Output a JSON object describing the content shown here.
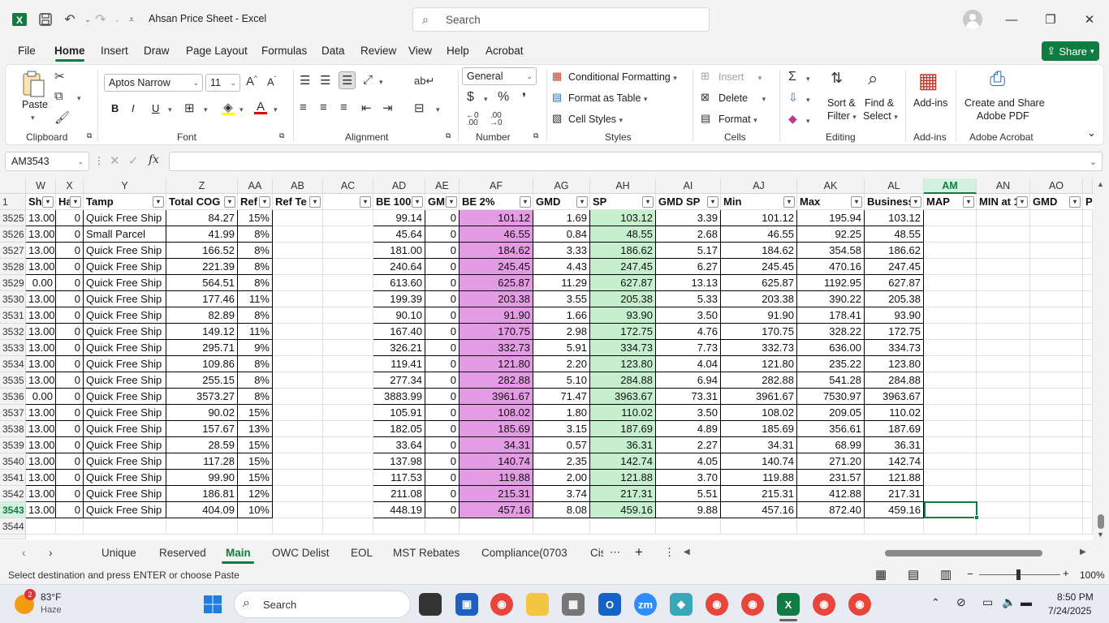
{
  "window": {
    "title": "Ahsan Price Sheet  -  Excel",
    "search_placeholder": "Search",
    "minimize": "—",
    "restore": "❐",
    "close": "✕"
  },
  "menu": {
    "items": [
      "File",
      "Home",
      "Insert",
      "Draw",
      "Page Layout",
      "Formulas",
      "Data",
      "Review",
      "View",
      "Help",
      "Acrobat"
    ],
    "share": "Share"
  },
  "ribbon": {
    "clipboard": {
      "paste": "Paste",
      "label": "Clipboard"
    },
    "font": {
      "name": "Aptos Narrow",
      "size": "11",
      "bold": "B",
      "italic": "I",
      "underline": "U",
      "label": "Font"
    },
    "alignment": {
      "label": "Alignment"
    },
    "number": {
      "format": "General",
      "label": "Number"
    },
    "styles": {
      "conditional": "Conditional Formatting",
      "format_table": "Format as Table",
      "cell_styles": "Cell Styles",
      "label": "Styles"
    },
    "cells": {
      "insert": "Insert",
      "delete": "Delete",
      "format": "Format",
      "label": "Cells"
    },
    "editing": {
      "sort1": "Sort &",
      "sort2": "Filter",
      "find1": "Find &",
      "find2": "Select",
      "label": "Editing"
    },
    "addins": {
      "btn": "Add-ins",
      "label": "Add-ins"
    },
    "acrobat": {
      "btn1": "Create and Share",
      "btn2": "Adobe PDF",
      "label": "Adobe Acrobat"
    }
  },
  "formula_bar": {
    "name_box": "AM3543",
    "fx": "fx",
    "value": ""
  },
  "grid": {
    "columns": [
      {
        "letter": "W",
        "header": "Sh"
      },
      {
        "letter": "X",
        "header": "Ha"
      },
      {
        "letter": "Y",
        "header": "Tamp"
      },
      {
        "letter": "Z",
        "header": "Total COG"
      },
      {
        "letter": "AA",
        "header": "Ref"
      },
      {
        "letter": "AB",
        "header": "Ref Te"
      },
      {
        "letter": "AC",
        "header": ""
      },
      {
        "letter": "AD",
        "header": "BE 100"
      },
      {
        "letter": "AE",
        "header": "GMI"
      },
      {
        "letter": "AF",
        "header": "BE 2%"
      },
      {
        "letter": "AG",
        "header": "GMD"
      },
      {
        "letter": "AH",
        "header": "SP"
      },
      {
        "letter": "AI",
        "header": "GMD SP"
      },
      {
        "letter": "AJ",
        "header": "Min"
      },
      {
        "letter": "AK",
        "header": "Max"
      },
      {
        "letter": "AL",
        "header": "Business"
      },
      {
        "letter": "AM",
        "header": "MAP"
      },
      {
        "letter": "AN",
        "header": "MIN at 1"
      },
      {
        "letter": "AO",
        "header": "GMD"
      },
      {
        "letter": "",
        "header": "P"
      }
    ],
    "header_row_num": "1",
    "rows": [
      {
        "n": "3525",
        "v": [
          "13.00",
          "0",
          "Quick Free Ship",
          "84.27",
          "15%",
          "",
          "",
          "99.14",
          "0",
          "101.12",
          "1.69",
          "103.12",
          "3.39",
          "101.12",
          "195.94",
          "103.12"
        ]
      },
      {
        "n": "3526",
        "v": [
          "13.00",
          "0",
          "Small Parcel",
          "41.99",
          "8%",
          "",
          "",
          "45.64",
          "0",
          "46.55",
          "0.84",
          "48.55",
          "2.68",
          "46.55",
          "92.25",
          "48.55"
        ]
      },
      {
        "n": "3527",
        "v": [
          "13.00",
          "0",
          "Quick Free Ship",
          "166.52",
          "8%",
          "",
          "",
          "181.00",
          "0",
          "184.62",
          "3.33",
          "186.62",
          "5.17",
          "184.62",
          "354.58",
          "186.62"
        ]
      },
      {
        "n": "3528",
        "v": [
          "13.00",
          "0",
          "Quick Free Ship",
          "221.39",
          "8%",
          "",
          "",
          "240.64",
          "0",
          "245.45",
          "4.43",
          "247.45",
          "6.27",
          "245.45",
          "470.16",
          "247.45"
        ]
      },
      {
        "n": "3529",
        "v": [
          "0.00",
          "0",
          "Quick Free Ship",
          "564.51",
          "8%",
          "",
          "",
          "613.60",
          "0",
          "625.87",
          "11.29",
          "627.87",
          "13.13",
          "625.87",
          "1192.95",
          "627.87"
        ]
      },
      {
        "n": "3530",
        "v": [
          "13.00",
          "0",
          "Quick Free Ship",
          "177.46",
          "11%",
          "",
          "",
          "199.39",
          "0",
          "203.38",
          "3.55",
          "205.38",
          "5.33",
          "203.38",
          "390.22",
          "205.38"
        ]
      },
      {
        "n": "3531",
        "v": [
          "13.00",
          "0",
          "Quick Free Ship",
          "82.89",
          "8%",
          "",
          "",
          "90.10",
          "0",
          "91.90",
          "1.66",
          "93.90",
          "3.50",
          "91.90",
          "178.41",
          "93.90"
        ]
      },
      {
        "n": "3532",
        "v": [
          "13.00",
          "0",
          "Quick Free Ship",
          "149.12",
          "11%",
          "",
          "",
          "167.40",
          "0",
          "170.75",
          "2.98",
          "172.75",
          "4.76",
          "170.75",
          "328.22",
          "172.75"
        ]
      },
      {
        "n": "3533",
        "v": [
          "13.00",
          "0",
          "Quick Free Ship",
          "295.71",
          "9%",
          "",
          "",
          "326.21",
          "0",
          "332.73",
          "5.91",
          "334.73",
          "7.73",
          "332.73",
          "636.00",
          "334.73"
        ]
      },
      {
        "n": "3534",
        "v": [
          "13.00",
          "0",
          "Quick Free Ship",
          "109.86",
          "8%",
          "",
          "",
          "119.41",
          "0",
          "121.80",
          "2.20",
          "123.80",
          "4.04",
          "121.80",
          "235.22",
          "123.80"
        ]
      },
      {
        "n": "3535",
        "v": [
          "13.00",
          "0",
          "Quick Free Ship",
          "255.15",
          "8%",
          "",
          "",
          "277.34",
          "0",
          "282.88",
          "5.10",
          "284.88",
          "6.94",
          "282.88",
          "541.28",
          "284.88"
        ]
      },
      {
        "n": "3536",
        "v": [
          "0.00",
          "0",
          "Quick Free Ship",
          "3573.27",
          "8%",
          "",
          "",
          "3883.99",
          "0",
          "3961.67",
          "71.47",
          "3963.67",
          "73.31",
          "3961.67",
          "7530.97",
          "3963.67"
        ]
      },
      {
        "n": "3537",
        "v": [
          "13.00",
          "0",
          "Quick Free Ship",
          "90.02",
          "15%",
          "",
          "",
          "105.91",
          "0",
          "108.02",
          "1.80",
          "110.02",
          "3.50",
          "108.02",
          "209.05",
          "110.02"
        ]
      },
      {
        "n": "3538",
        "v": [
          "13.00",
          "0",
          "Quick Free Ship",
          "157.67",
          "13%",
          "",
          "",
          "182.05",
          "0",
          "185.69",
          "3.15",
          "187.69",
          "4.89",
          "185.69",
          "356.61",
          "187.69"
        ]
      },
      {
        "n": "3539",
        "v": [
          "13.00",
          "0",
          "Quick Free Ship",
          "28.59",
          "15%",
          "",
          "",
          "33.64",
          "0",
          "34.31",
          "0.57",
          "36.31",
          "2.27",
          "34.31",
          "68.99",
          "36.31"
        ]
      },
      {
        "n": "3540",
        "v": [
          "13.00",
          "0",
          "Quick Free Ship",
          "117.28",
          "15%",
          "",
          "",
          "137.98",
          "0",
          "140.74",
          "2.35",
          "142.74",
          "4.05",
          "140.74",
          "271.20",
          "142.74"
        ]
      },
      {
        "n": "3541",
        "v": [
          "13.00",
          "0",
          "Quick Free Ship",
          "99.90",
          "15%",
          "",
          "",
          "117.53",
          "0",
          "119.88",
          "2.00",
          "121.88",
          "3.70",
          "119.88",
          "231.57",
          "121.88"
        ]
      },
      {
        "n": "3542",
        "v": [
          "13.00",
          "0",
          "Quick Free Ship",
          "186.81",
          "12%",
          "",
          "",
          "211.08",
          "0",
          "215.31",
          "3.74",
          "217.31",
          "5.51",
          "215.31",
          "412.88",
          "217.31"
        ]
      },
      {
        "n": "3543",
        "v": [
          "13.00",
          "0",
          "Quick Free Ship",
          "404.09",
          "10%",
          "",
          "",
          "448.19",
          "0",
          "457.16",
          "8.08",
          "459.16",
          "9.88",
          "457.16",
          "872.40",
          "459.16"
        ]
      }
    ],
    "empty_row": "3544",
    "colors": {
      "pink": "#e39be3",
      "green": "#c6efce",
      "yellow": "#ffff00",
      "accent": "#107c41"
    }
  },
  "sheet_tabs": [
    "Unique",
    "Reserved",
    "Main",
    "OWC Delist",
    "EOL",
    "MST Rebates",
    "Compliance(0703",
    "Cis"
  ],
  "active_tab": "Main",
  "status": {
    "message": "Select destination and press ENTER or choose Paste",
    "zoom": "100%"
  },
  "taskbar": {
    "weather_temp": "83°F",
    "weather_desc": "Haze",
    "weather_badge": "2",
    "search": "Search",
    "time": "8:50 PM",
    "date": "7/24/2025"
  }
}
